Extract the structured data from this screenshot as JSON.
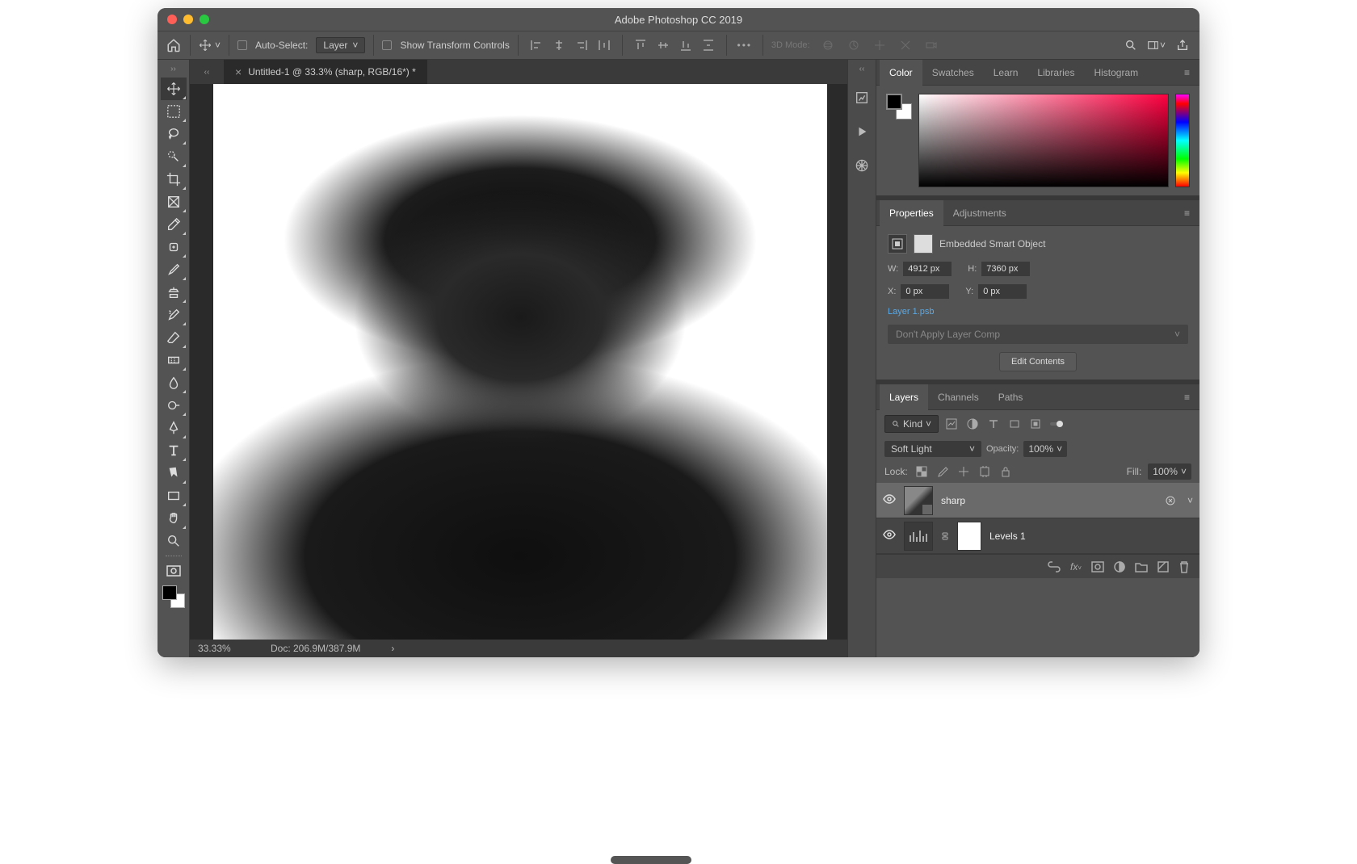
{
  "window": {
    "title": "Adobe Photoshop CC 2019"
  },
  "optionsbar": {
    "auto_select_label": "Auto-Select:",
    "auto_select_target": "Layer",
    "transform_label": "Show Transform Controls",
    "mode3d_label": "3D Mode:"
  },
  "document": {
    "tab_title": "Untitled-1 @ 33.3% (sharp, RGB/16*) *",
    "zoom": "33.33%",
    "docsize": "Doc: 206.9M/387.9M"
  },
  "panels": {
    "color_tabs": [
      "Color",
      "Swatches",
      "Learn",
      "Libraries",
      "Histogram"
    ],
    "props_tabs": [
      "Properties",
      "Adjustments"
    ],
    "layers_tabs": [
      "Layers",
      "Channels",
      "Paths"
    ]
  },
  "properties": {
    "type_label": "Embedded Smart Object",
    "w_label": "W:",
    "w_value": "4912 px",
    "h_label": "H:",
    "h_value": "7360 px",
    "x_label": "X:",
    "x_value": "0 px",
    "y_label": "Y:",
    "y_value": "0 px",
    "linked_file": "Layer 1.psb",
    "layer_comp": "Don't Apply Layer Comp",
    "edit_button": "Edit Contents"
  },
  "layers": {
    "kind_label": "Kind",
    "blend_mode": "Soft Light",
    "opacity_label": "Opacity:",
    "opacity_value": "100%",
    "lock_label": "Lock:",
    "fill_label": "Fill:",
    "fill_value": "100%",
    "items": [
      {
        "name": "sharp"
      },
      {
        "name": "Levels 1"
      }
    ]
  }
}
